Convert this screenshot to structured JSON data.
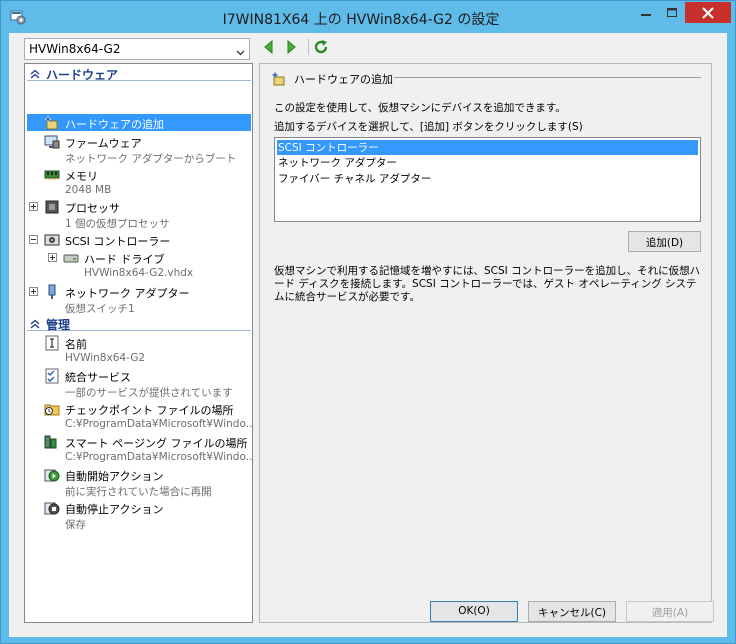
{
  "window": {
    "title": "I7WIN81X64 上の HVWin8x64-G2 の設定"
  },
  "vm_selector": {
    "value": "HVWin8x64-G2"
  },
  "tree": {
    "sections": {
      "hardware": "ハードウェア",
      "management": "管理"
    },
    "items": [
      {
        "label": "ハードウェアの追加",
        "sub": "",
        "icon": "add-hardware-icon"
      },
      {
        "label": "ファームウェア",
        "sub": "ネットワーク アダプターからブート",
        "icon": "firmware-icon"
      },
      {
        "label": "メモリ",
        "sub": "2048 MB",
        "icon": "memory-icon"
      },
      {
        "label": "プロセッサ",
        "sub": "1 個の仮想プロセッサ",
        "icon": "processor-icon"
      },
      {
        "label": "SCSI コントローラー",
        "sub": "",
        "icon": "scsi-controller-icon"
      },
      {
        "label": "ハード ドライブ",
        "sub": "HVWin8x64-G2.vhdx",
        "icon": "hard-drive-icon"
      },
      {
        "label": "ネットワーク アダプター",
        "sub": "仮想スイッチ1",
        "icon": "network-adapter-icon"
      },
      {
        "label": "名前",
        "sub": "HVWin8x64-G2",
        "icon": "name-icon"
      },
      {
        "label": "統合サービス",
        "sub": "一部のサービスが提供されています",
        "icon": "integration-services-icon"
      },
      {
        "label": "チェックポイント ファイルの場所",
        "sub": "C:¥ProgramData¥Microsoft¥Windo...",
        "icon": "checkpoint-folder-icon"
      },
      {
        "label": "スマート ページング ファイルの場所",
        "sub": "C:¥ProgramData¥Microsoft¥Windo...",
        "icon": "smart-paging-icon"
      },
      {
        "label": "自動開始アクション",
        "sub": "前に実行されていた場合に再開",
        "icon": "auto-start-icon"
      },
      {
        "label": "自動停止アクション",
        "sub": "保存",
        "icon": "auto-stop-icon"
      }
    ]
  },
  "panel": {
    "title": "ハードウェアの追加",
    "intro": "この設定を使用して、仮想マシンにデバイスを追加できます。",
    "instruction": "追加するデバイスを選択して、[追加] ボタンをクリックします(S)",
    "devices": [
      "SCSI コントローラー",
      "ネットワーク アダプター",
      "ファイバー チャネル アダプター"
    ],
    "selected_device": "SCSI コントローラー",
    "add_label": "追加(D)",
    "description": "仮想マシンで利用する記憶域を増やすには、SCSI コントローラーを追加し、それに仮想ハード ディスクを接続します。SCSI コントローラーでは、ゲスト オペレーティング システムに統合サービスが必要です。"
  },
  "buttons": {
    "ok": "OK(O)",
    "cancel": "キャンセル(C)",
    "apply": "適用(A)"
  },
  "colors": {
    "selection": "#3399ff",
    "window_frame": "#5fbbe8",
    "close_button": "#c7302b",
    "section_text": "#1e3e8c"
  }
}
